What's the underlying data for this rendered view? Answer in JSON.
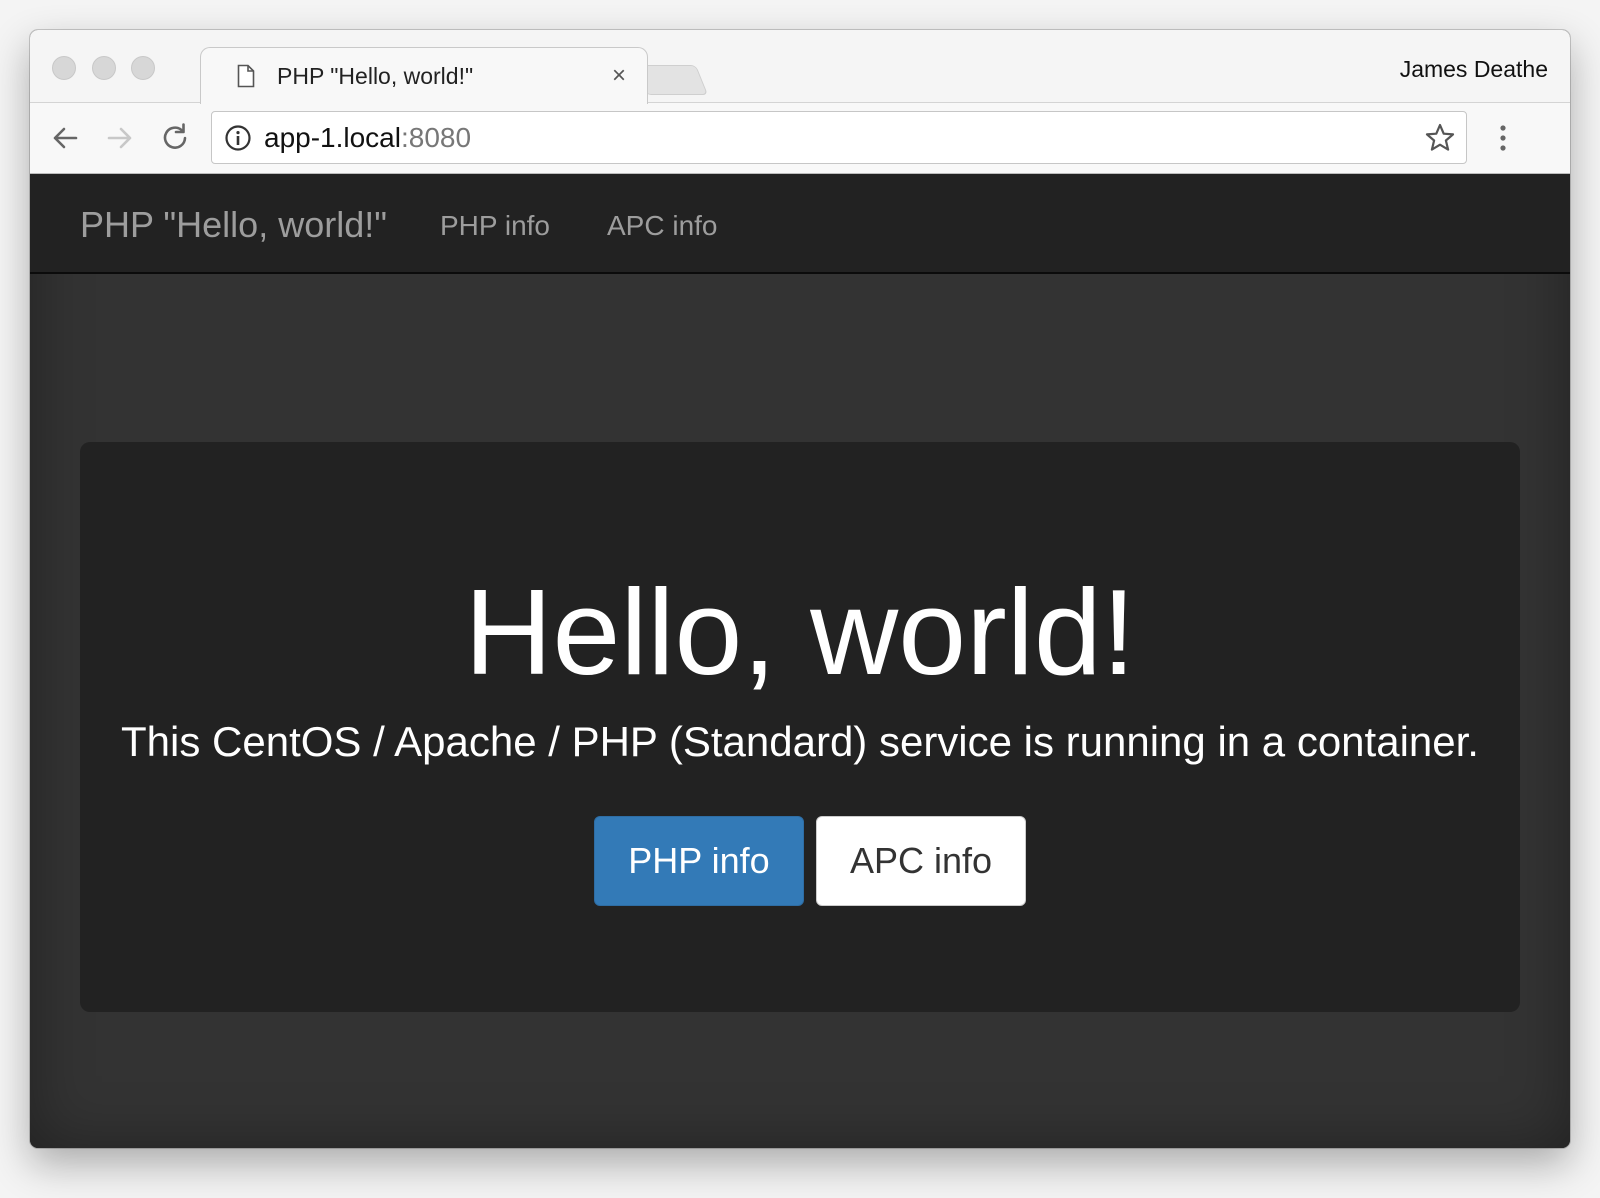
{
  "browser": {
    "tab": {
      "title": "PHP \"Hello, world!\"",
      "close_glyph": "×",
      "icon": "page-icon"
    },
    "profile_name": "James Deathe",
    "address": {
      "host": "app-1.local",
      "port": ":8080"
    },
    "icons": {
      "back": "arrow-left-icon",
      "forward": "arrow-right-icon",
      "reload": "reload-icon",
      "site_info": "info-icon",
      "bookmark": "star-icon",
      "menu": "more-vertical-icon"
    }
  },
  "navbar": {
    "brand": "PHP \"Hello, world!\"",
    "links": [
      "PHP info",
      "APC info"
    ]
  },
  "jumbotron": {
    "title": "Hello, world!",
    "text": "This CentOS / Apache / PHP (Standard) service is running in a container.",
    "buttons": {
      "primary": "PHP info",
      "secondary": "APC info"
    }
  },
  "colors": {
    "navbar_bg": "#222222",
    "page_bg": "#333333",
    "primary_button": "#337ab7",
    "nav_text": "#9d9d9d"
  }
}
